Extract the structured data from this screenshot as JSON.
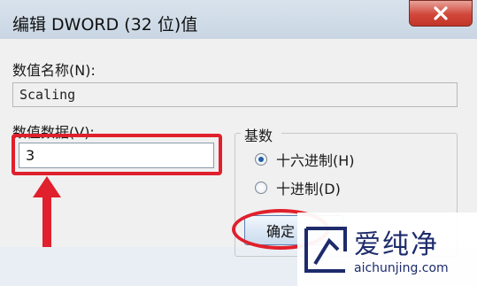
{
  "window": {
    "title": "编辑 DWORD (32 位)值"
  },
  "fields": {
    "name_label": "数值名称(N):",
    "name_value": "Scaling",
    "data_label": "数值数据(V):",
    "data_value": "3"
  },
  "base": {
    "label": "基数",
    "options": [
      {
        "label": "十六进制(H)",
        "checked": true
      },
      {
        "label": "十进制(D)",
        "checked": false
      }
    ]
  },
  "buttons": {
    "ok_label": "确定"
  },
  "annotations": {
    "highlight_color": "#e0202c"
  },
  "watermark": {
    "name": "爱纯净",
    "url": "aichunjing.com",
    "color": "#1d2b6b"
  }
}
